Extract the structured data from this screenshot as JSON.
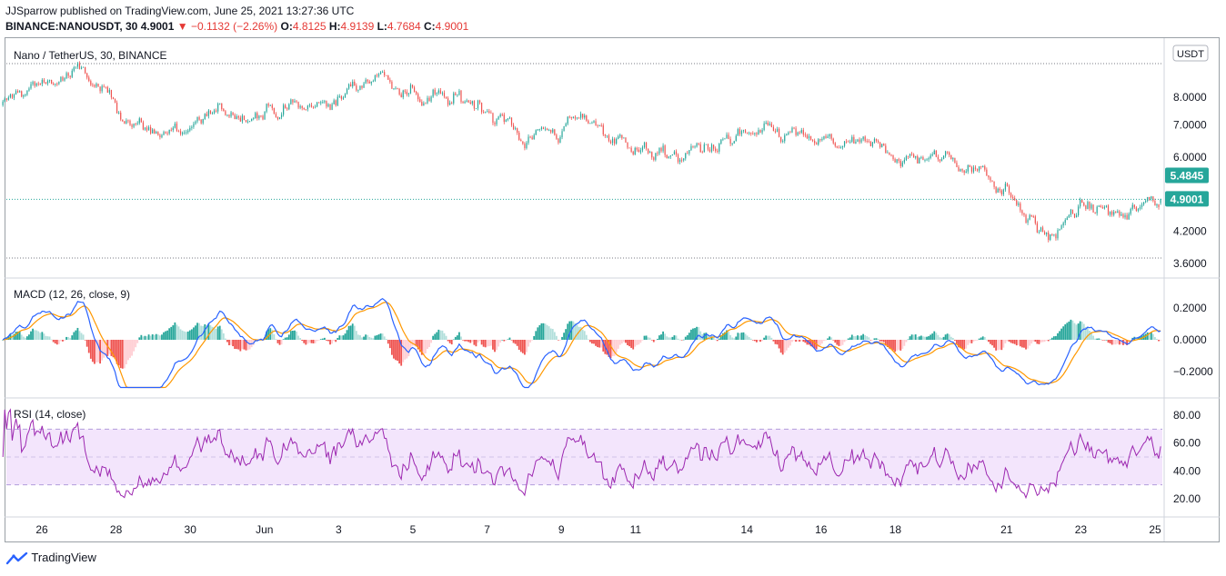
{
  "header": {
    "publish_line": "JJSparrow published on TradingView.com, June 25, 2021 13:27:36 UTC",
    "symbol": "BINANCE:NANOUSDT, 30",
    "last": "4.9001",
    "change": "▼ −0.1132 (−2.26%)",
    "o_label": "O:",
    "o": "4.8125",
    "h_label": "H:",
    "h": "4.9139",
    "l_label": "L:",
    "l": "4.7684",
    "c_label": "C:",
    "c": "4.9001"
  },
  "brand": "TradingView",
  "colors": {
    "up": "#26a69a",
    "down": "#ef5350",
    "macd": "#2962ff",
    "signal": "#ff9800",
    "rsi": "#9c27b0",
    "rsi_band": "#f3e5fc",
    "last_price": "#26a69a"
  },
  "chart_data": [
    {
      "type": "candlestick",
      "title": "Nano / TetherUS, 30, BINANCE",
      "currency": "USDT",
      "scale": "log",
      "y_ticks": [
        "8.0000",
        "7.0000",
        "6.0000",
        "4.2000",
        "3.6000"
      ],
      "y_tick_values": [
        8.0,
        7.0,
        6.0,
        4.2,
        3.6
      ],
      "price_labels": [
        {
          "label": "5.4845",
          "value": 5.4845
        },
        {
          "label": "4.9001",
          "value": 4.9001
        }
      ],
      "x_ticks": [
        "26",
        "28",
        "30",
        "Jun",
        "3",
        "5",
        "7",
        "9",
        "11",
        "14",
        "16",
        "18",
        "21",
        "23",
        "25"
      ],
      "approx_close_path": [
        {
          "x": "May 25",
          "y": 7.7
        },
        {
          "x": "May 26",
          "y": 8.6
        },
        {
          "x": "May 27",
          "y": 8.9
        },
        {
          "x": "May 28",
          "y": 7.6
        },
        {
          "x": "May 29",
          "y": 6.7
        },
        {
          "x": "May 30",
          "y": 7.0
        },
        {
          "x": "May 31",
          "y": 7.4
        },
        {
          "x": "Jun 1",
          "y": 7.5
        },
        {
          "x": "Jun 2",
          "y": 7.5
        },
        {
          "x": "Jun 3",
          "y": 7.9
        },
        {
          "x": "Jun 4",
          "y": 9.0
        },
        {
          "x": "Jun 5",
          "y": 8.2
        },
        {
          "x": "Jun 6",
          "y": 7.9
        },
        {
          "x": "Jun 7",
          "y": 7.8
        },
        {
          "x": "Jun 8",
          "y": 6.6
        },
        {
          "x": "Jun 9",
          "y": 6.9
        },
        {
          "x": "Jun 10",
          "y": 7.0
        },
        {
          "x": "Jun 11",
          "y": 6.3
        },
        {
          "x": "Jun 12",
          "y": 6.0
        },
        {
          "x": "Jun 13",
          "y": 6.3
        },
        {
          "x": "Jun 14",
          "y": 6.6
        },
        {
          "x": "Jun 15",
          "y": 6.7
        },
        {
          "x": "Jun 16",
          "y": 6.4
        },
        {
          "x": "Jun 17",
          "y": 6.3
        },
        {
          "x": "Jun 18",
          "y": 6.0
        },
        {
          "x": "Jun 19",
          "y": 5.95
        },
        {
          "x": "Jun 20",
          "y": 5.8
        },
        {
          "x": "Jun 21",
          "y": 5.3
        },
        {
          "x": "Jun 22",
          "y": 4.1
        },
        {
          "x": "Jun 23",
          "y": 4.6
        },
        {
          "x": "Jun 24",
          "y": 4.5
        },
        {
          "x": "Jun 25",
          "y": 4.9
        }
      ]
    },
    {
      "type": "line",
      "title": "MACD (12, 26, close, 9)",
      "y_ticks": [
        "0.2000",
        "0.0000",
        "−0.2000"
      ],
      "y_tick_values": [
        0.2,
        0.0,
        -0.2
      ],
      "series_colors": [
        "#2962ff",
        "#ff9800"
      ]
    },
    {
      "type": "line",
      "title": "RSI (14, close)",
      "y_ticks": [
        "80.00",
        "60.00",
        "40.00",
        "20.00"
      ],
      "y_tick_values": [
        80,
        60,
        40,
        20
      ],
      "band": [
        30,
        70
      ]
    }
  ]
}
